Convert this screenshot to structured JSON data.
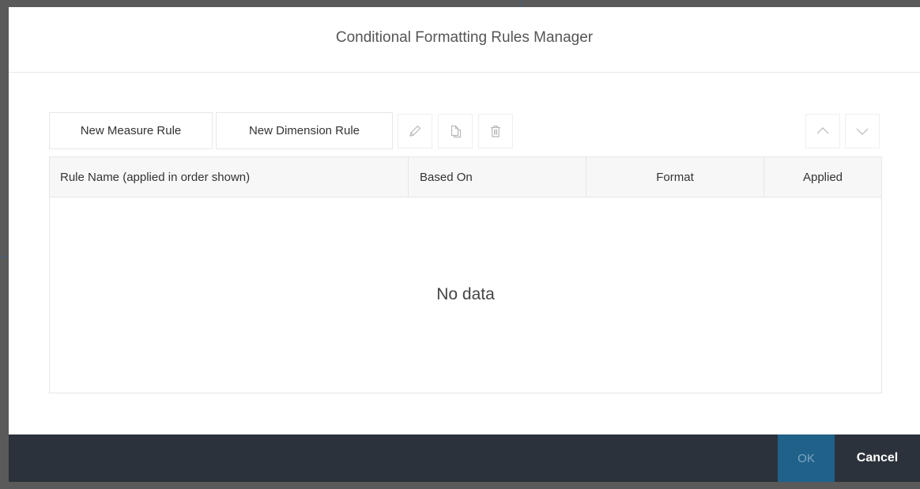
{
  "dialog": {
    "title": "Conditional Formatting Rules Manager"
  },
  "toolbar": {
    "new_measure_rule": "New Measure Rule",
    "new_dimension_rule": "New Dimension Rule",
    "icons": [
      "pencil-icon",
      "copy-icon",
      "trash-icon",
      "chevron-up-icon",
      "chevron-down-icon"
    ]
  },
  "grid": {
    "columns": [
      "Rule Name (applied in order shown)",
      "Based On",
      "Format",
      "Applied"
    ],
    "empty_text": "No data"
  },
  "footer": {
    "ok_label": "OK",
    "cancel_label": "Cancel"
  },
  "colors": {
    "footer_bg": "#2c323b",
    "ok_bg": "#1f6189",
    "ok_text_disabled": "#7fa7c3",
    "header_row_bg": "#f7f7f8",
    "border": "#e5e6e8"
  }
}
